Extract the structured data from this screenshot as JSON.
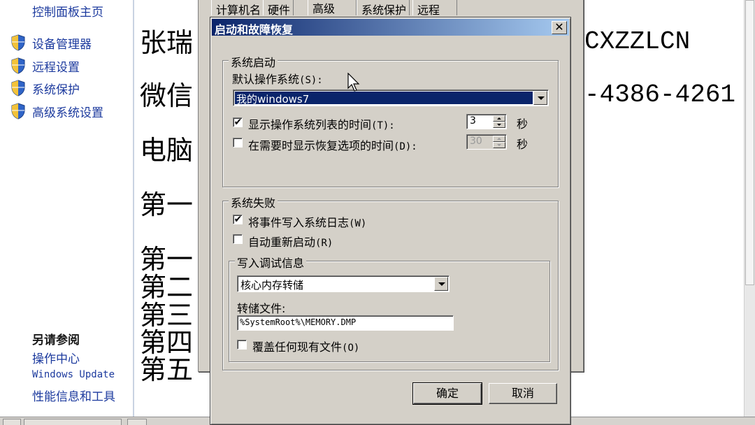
{
  "sidebar": {
    "home_link": "控制面板主页",
    "items": [
      {
        "label": "设备管理器"
      },
      {
        "label": "远程设置"
      },
      {
        "label": "系统保护"
      },
      {
        "label": "高级系统设置"
      }
    ],
    "see_also_title": "另请参阅",
    "see_also": [
      "操作中心",
      "Windows Update",
      "性能信息和工具"
    ]
  },
  "background_doc": {
    "lines_left": [
      "张瑞",
      "微信",
      "电脑",
      "第一",
      "第一",
      "第二",
      "第三",
      "第四",
      "第五"
    ],
    "right_1": "CXZZLCN",
    "right_2": "-4386-4261"
  },
  "system_properties": {
    "tabs": [
      "计算机名",
      "硬件",
      "高级",
      "系统保护",
      "远程"
    ],
    "active_tab": "高级"
  },
  "dialog": {
    "title": "启动和故障恢复",
    "startup": {
      "legend": "系统启动",
      "default_os_label": "默认操作系统",
      "default_os_acc": "(S):",
      "default_os_value": "我的windows7",
      "show_list": {
        "label": "显示操作系统列表的时间",
        "acc": "(T):",
        "checked": true,
        "value": "3",
        "unit": "秒"
      },
      "show_recovery": {
        "label": "在需要时显示恢复选项的时间",
        "acc": "(D):",
        "checked": false,
        "value": "30",
        "unit": "秒"
      }
    },
    "failure": {
      "legend": "系统失败",
      "write_event": {
        "label": "将事件写入系统日志",
        "acc": "(W)",
        "checked": true
      },
      "auto_restart": {
        "label": "自动重新启动",
        "acc": "(R)",
        "checked": false
      },
      "debug": {
        "legend": "写入调试信息",
        "type_value": "核心内存转储",
        "dump_file_label": "转储文件:",
        "dump_file_value": "%SystemRoot%\\MEMORY.DMP",
        "overwrite": {
          "label": "覆盖任何现有文件",
          "acc": "(O)",
          "checked": false
        }
      }
    },
    "ok_label": "确定",
    "cancel_label": "取消"
  },
  "colors": {
    "titlebar_start": "#0a246a",
    "titlebar_end": "#a6caf0",
    "dialog_face": "#d4d0c8",
    "link": "#1c3a9e"
  }
}
